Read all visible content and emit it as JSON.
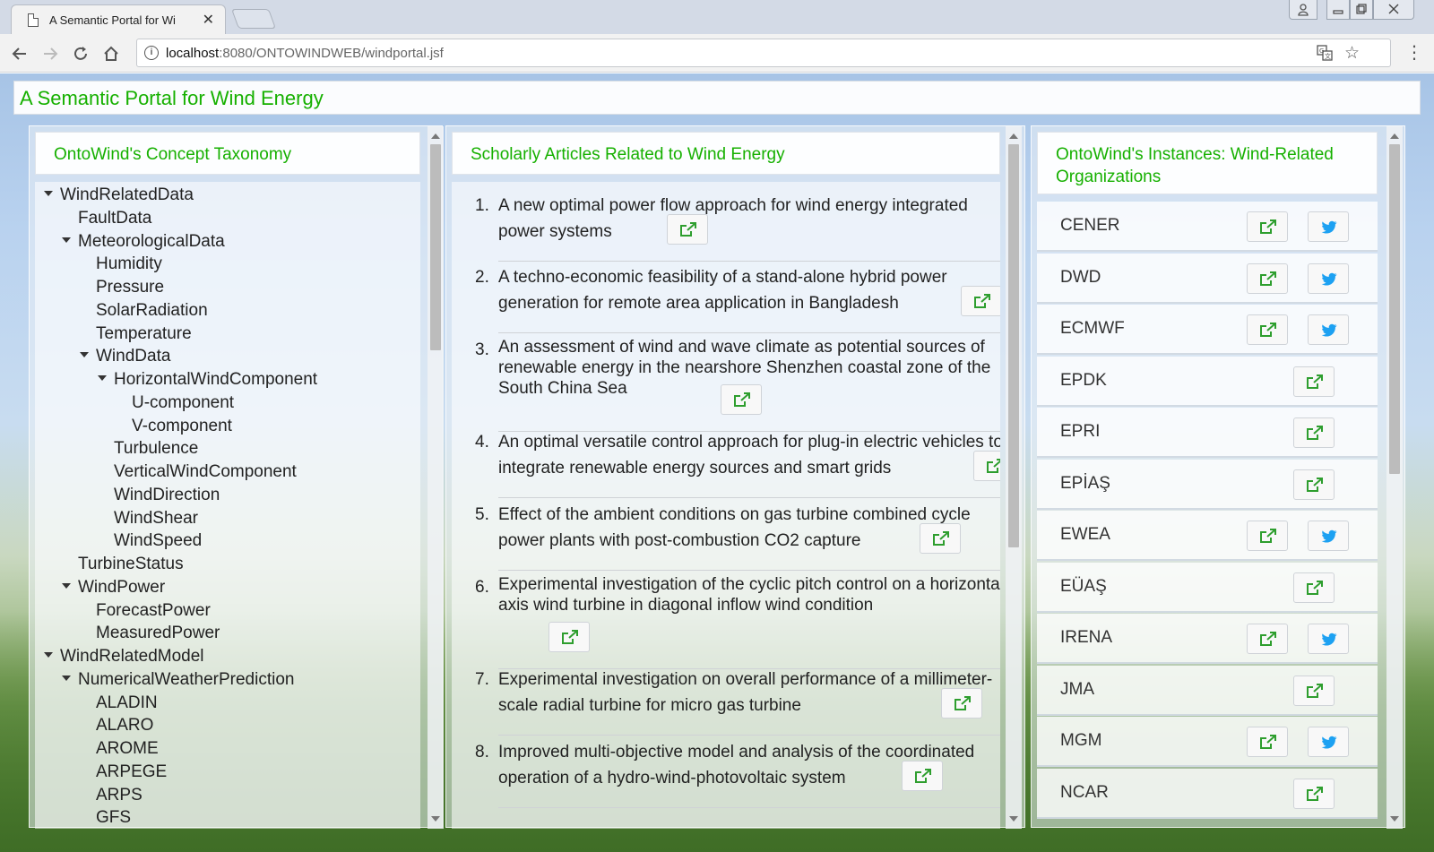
{
  "browser": {
    "tab_title": "A Semantic Portal for Wi",
    "tab_close": "✕",
    "url_host": "localhost",
    "url_path": ":8080/ONTOWINDWEB/windportal.jsf",
    "info_icon": "i"
  },
  "app": {
    "title": "A Semantic Portal for Wind Energy"
  },
  "taxonomy": {
    "header": "OntoWind's Concept Taxonomy",
    "nodes": [
      {
        "label": "WindRelatedData",
        "expanded": true
      },
      {
        "label": "FaultData"
      },
      {
        "label": "MeteorologicalData",
        "expanded": true
      },
      {
        "label": "Humidity"
      },
      {
        "label": "Pressure"
      },
      {
        "label": "SolarRadiation"
      },
      {
        "label": "Temperature"
      },
      {
        "label": "WindData",
        "expanded": true
      },
      {
        "label": "HorizontalWindComponent",
        "expanded": true
      },
      {
        "label": "U-component"
      },
      {
        "label": "V-component"
      },
      {
        "label": "Turbulence"
      },
      {
        "label": "VerticalWindComponent"
      },
      {
        "label": "WindDirection"
      },
      {
        "label": "WindShear"
      },
      {
        "label": "WindSpeed"
      },
      {
        "label": "TurbineStatus"
      },
      {
        "label": "WindPower",
        "expanded": true
      },
      {
        "label": "ForecastPower"
      },
      {
        "label": "MeasuredPower"
      },
      {
        "label": "WindRelatedModel",
        "expanded": true
      },
      {
        "label": "NumericalWeatherPrediction",
        "expanded": true
      },
      {
        "label": "ALADIN"
      },
      {
        "label": "ALARO"
      },
      {
        "label": "AROME"
      },
      {
        "label": "ARPEGE"
      },
      {
        "label": "ARPS"
      },
      {
        "label": "GFS"
      }
    ]
  },
  "articles": {
    "header": "Scholarly Articles Related to Wind Energy",
    "items": [
      {
        "num": "1.",
        "title": "A new optimal power flow approach for wind energy integrated power systems"
      },
      {
        "num": "2.",
        "title": "A techno-economic feasibility of a stand-alone hybrid power generation for remote area application in Bangladesh"
      },
      {
        "num": "3.",
        "title": "An assessment of wind and wave climate as potential sources of renewable energy in the nearshore Shenzhen coastal zone of the South China Sea"
      },
      {
        "num": "4.",
        "title": "An optimal versatile control approach for plug-in electric vehicles to integrate renewable energy sources and smart grids"
      },
      {
        "num": "5.",
        "title": "Effect of the ambient conditions on gas turbine combined cycle power plants with post-combustion CO2 capture"
      },
      {
        "num": "6.",
        "title": "Experimental investigation of the cyclic pitch control on a horizontal axis wind turbine in diagonal inflow wind condition"
      },
      {
        "num": "7.",
        "title": "Experimental investigation on overall performance of a millimeter-scale radial turbine for micro gas turbine"
      },
      {
        "num": "8.",
        "title": "Improved multi-objective model and analysis of the coordinated operation of a hydro-wind-photovoltaic system"
      }
    ]
  },
  "organizations": {
    "header": "OntoWind's Instances: Wind-Related Organizations",
    "items": [
      {
        "name": "CENER",
        "twitter": true
      },
      {
        "name": "DWD",
        "twitter": true
      },
      {
        "name": "ECMWF",
        "twitter": true
      },
      {
        "name": "EPDK",
        "twitter": false
      },
      {
        "name": "EPRI",
        "twitter": false
      },
      {
        "name": "EPİAŞ",
        "twitter": false
      },
      {
        "name": "EWEA",
        "twitter": true
      },
      {
        "name": "EÜAŞ",
        "twitter": false
      },
      {
        "name": "IRENA",
        "twitter": true
      },
      {
        "name": "JMA",
        "twitter": false
      },
      {
        "name": "MGM",
        "twitter": true
      },
      {
        "name": "NCAR",
        "twitter": false
      }
    ]
  },
  "colors": {
    "accent_green": "#16b000",
    "twitter_blue": "#1da1f2",
    "link_icon_green": "#2e9e2e"
  },
  "icons": {
    "external_link": "external-link-icon",
    "twitter": "twitter-icon"
  }
}
